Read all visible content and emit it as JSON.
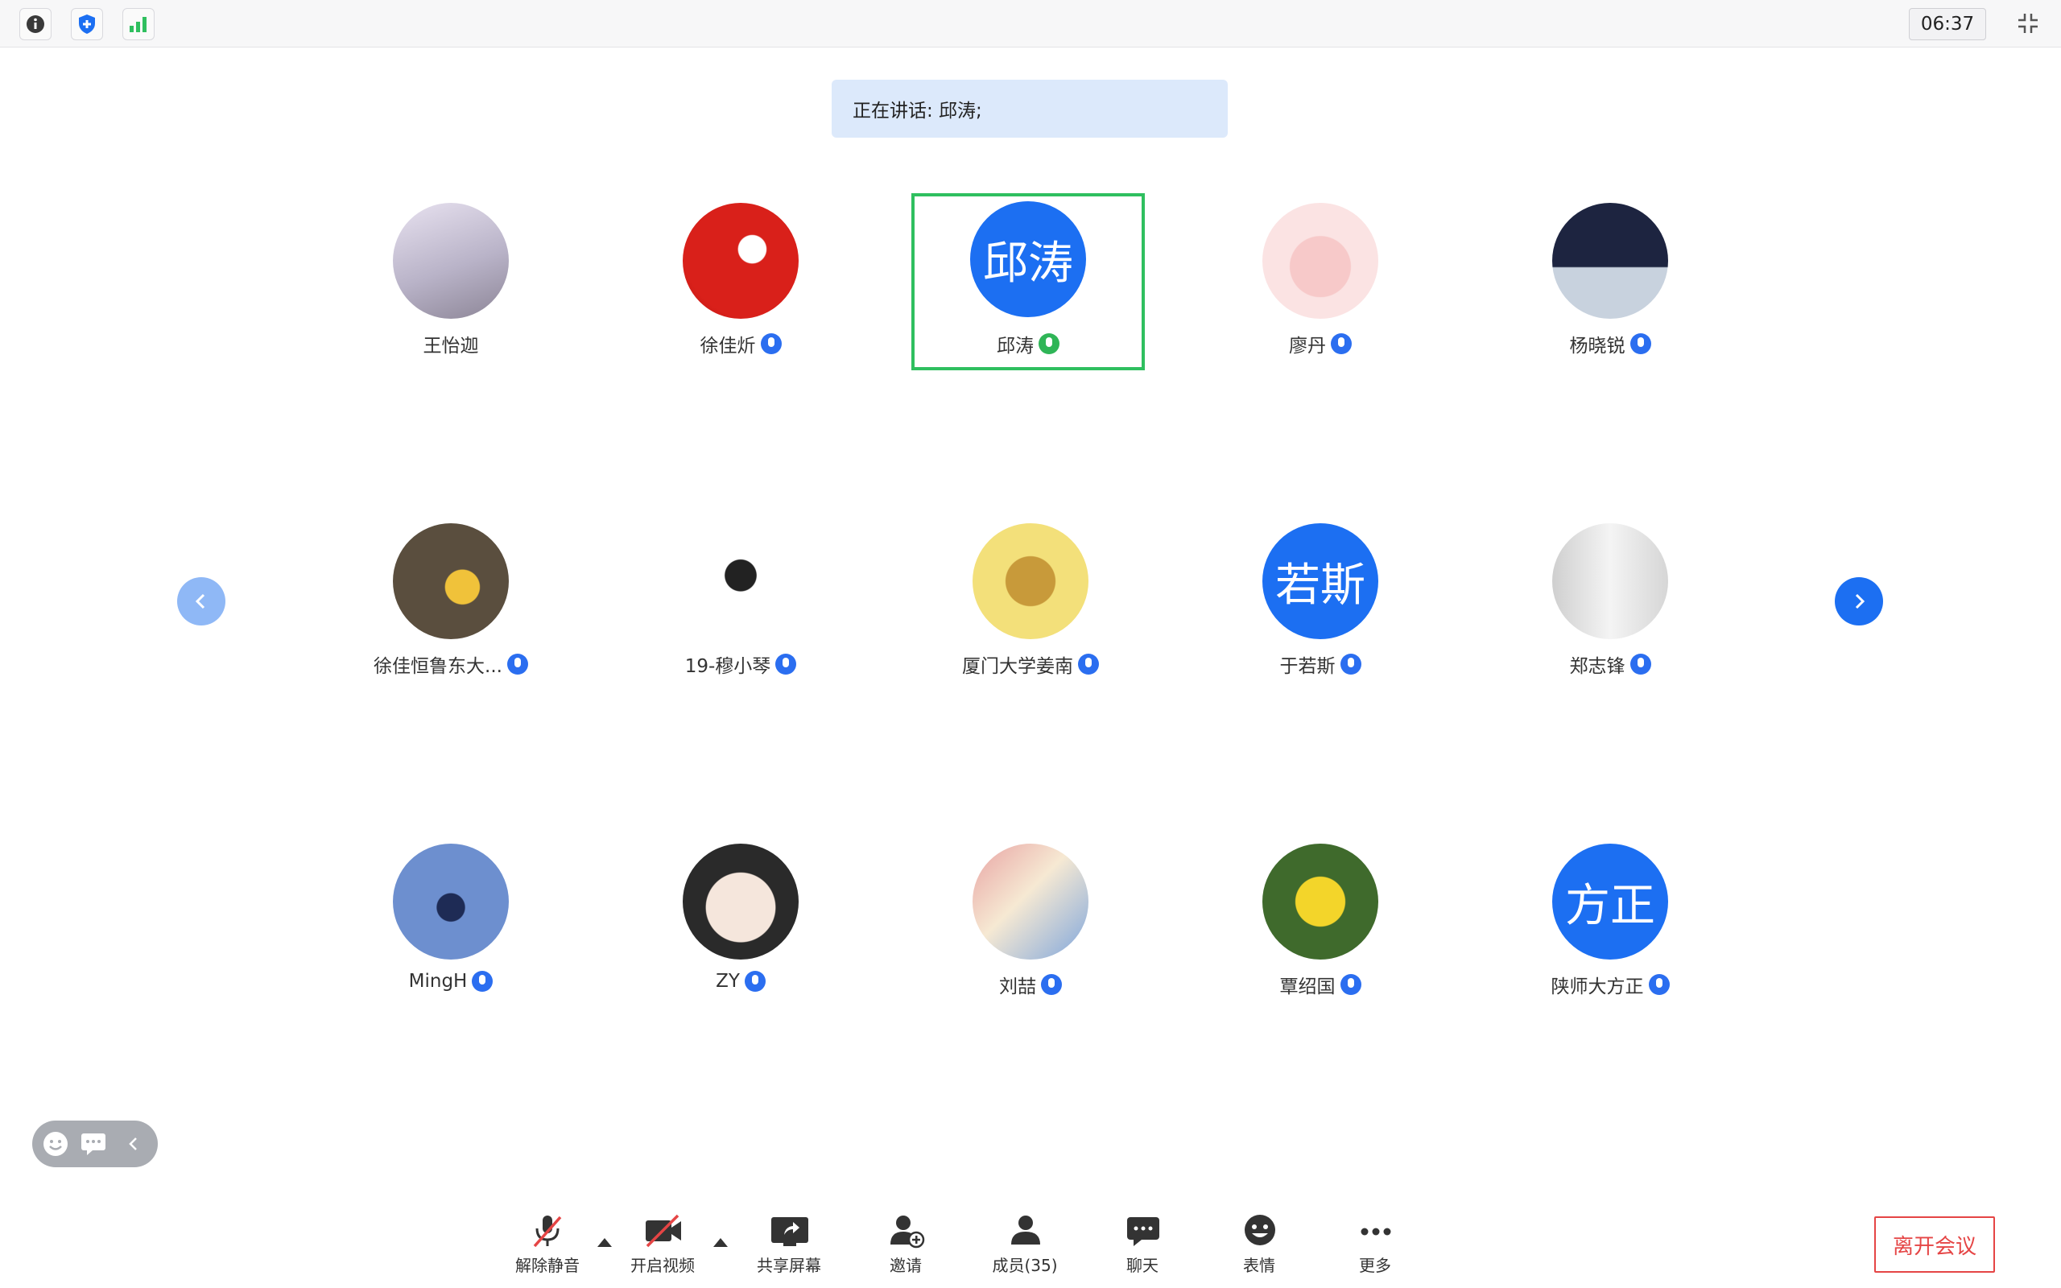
{
  "topbar": {
    "timer": "06:37",
    "icons": [
      "info-icon",
      "shield-icon",
      "signal-icon",
      "exit-fullscreen-icon"
    ]
  },
  "speaking_banner": "正在讲话: 邱涛;",
  "participants": [
    {
      "name": "王怡迦",
      "avatar": "photo",
      "mic": "none"
    },
    {
      "name": "徐佳炘",
      "avatar": "photo",
      "mic": "muted"
    },
    {
      "name": "邱涛",
      "avatar_text": "邱涛",
      "mic": "speaking",
      "active": true
    },
    {
      "name": "廖丹",
      "avatar": "photo",
      "mic": "muted"
    },
    {
      "name": "杨晓锐",
      "avatar": "photo",
      "mic": "muted"
    },
    {
      "name": "徐佳恒鲁东大...",
      "avatar": "photo",
      "mic": "muted"
    },
    {
      "name": "19-穆小琴",
      "avatar": "photo",
      "mic": "muted"
    },
    {
      "name": "厦门大学姜南",
      "avatar": "photo",
      "mic": "muted"
    },
    {
      "name": "于若斯",
      "avatar_text": "若斯",
      "mic": "muted"
    },
    {
      "name": "郑志锋",
      "avatar": "photo",
      "mic": "muted"
    },
    {
      "name": "MingH",
      "avatar": "photo",
      "mic": "muted"
    },
    {
      "name": "ZY",
      "avatar": "photo",
      "mic": "muted"
    },
    {
      "name": "刘喆",
      "avatar": "photo",
      "mic": "muted"
    },
    {
      "name": "覃绍国",
      "avatar": "photo",
      "mic": "muted"
    },
    {
      "name": "陕师大方正",
      "avatar_text": "方正",
      "mic": "muted"
    }
  ],
  "toolbar": {
    "unmute": "解除静音",
    "start_video": "开启视频",
    "share_screen": "共享屏幕",
    "invite": "邀请",
    "members": "成员(35)",
    "chat": "聊天",
    "reactions": "表情",
    "more": "更多",
    "leave": "离开会议"
  },
  "colors": {
    "accent": "#1c6ff2",
    "speaking_banner_bg": "#dce9fb",
    "active_border": "#2fbf5f",
    "leave": "#e54545"
  }
}
